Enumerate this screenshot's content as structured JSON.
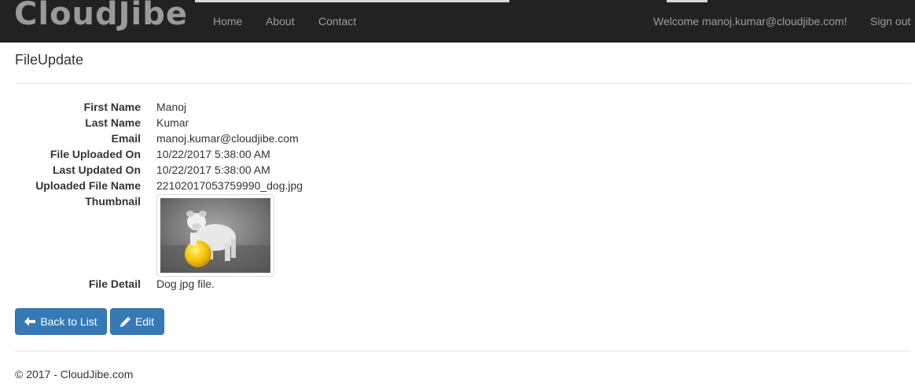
{
  "navbar": {
    "brand": "CloudJibe",
    "links": [
      "Home",
      "About",
      "Contact"
    ],
    "welcome": "Welcome manoj.kumar@cloudjibe.com!",
    "signout": "Sign out"
  },
  "page": {
    "title": "FileUpdate"
  },
  "details": {
    "first_name_label": "First Name",
    "first_name": "Manoj",
    "last_name_label": "Last Name",
    "last_name": "Kumar",
    "email_label": "Email",
    "email": "manoj.kumar@cloudjibe.com",
    "uploaded_on_label": "File Uploaded On",
    "uploaded_on": "10/22/2017 5:38:00 AM",
    "updated_on_label": "Last Updated On",
    "updated_on": "10/22/2017 5:38:00 AM",
    "file_name_label": "Uploaded File Name",
    "file_name": "22102017053759990_dog.jpg",
    "thumbnail_label": "Thumbnail",
    "file_detail_label": "File Detail",
    "file_detail": "Dog jpg file."
  },
  "actions": {
    "back_label": "Back to List",
    "edit_label": "Edit"
  },
  "footer": {
    "text": "© 2017 - CloudJibe.com"
  },
  "icons": {
    "back": "arrow-left-icon",
    "edit": "pencil-icon"
  },
  "colors": {
    "navbar": "#222222",
    "nav_text": "#9d9d9d",
    "primary": "#337ab7",
    "ball": "#f2c200"
  }
}
